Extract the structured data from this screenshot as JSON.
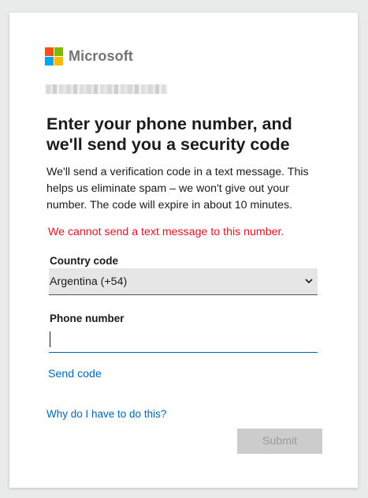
{
  "brand": {
    "name": "Microsoft",
    "logo_colors": [
      "#f25022",
      "#7fba00",
      "#00a4ef",
      "#ffb900"
    ]
  },
  "heading": "Enter your phone number, and we'll send you a security code",
  "description": "We'll send a verification code in a text message. This helps us eliminate spam – we won't give out your number. The code will expire in about 10 minutes.",
  "error_message": "We cannot send a text message to this number.",
  "country": {
    "label": "Country code",
    "selected": "Argentina (+54)"
  },
  "phone": {
    "label": "Phone number",
    "value": ""
  },
  "links": {
    "send_code": "Send code",
    "why": "Why do I have to do this?"
  },
  "submit": {
    "label": "Submit",
    "disabled": true
  },
  "colors": {
    "accent": "#0067b8",
    "error": "#e81123",
    "disabled_bg": "#cccccc",
    "disabled_text": "#9a9a9a"
  }
}
